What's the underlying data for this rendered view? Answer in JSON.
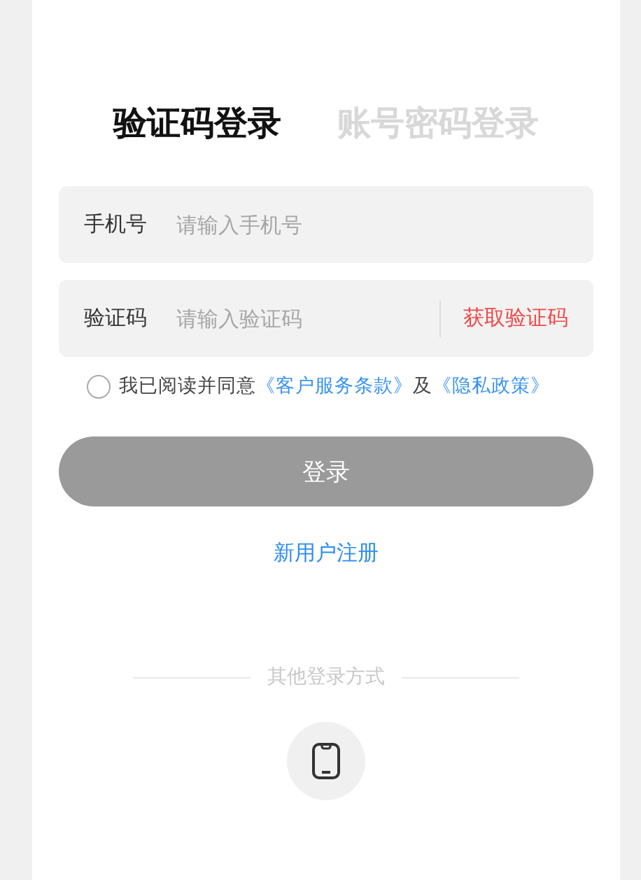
{
  "tabs": [
    {
      "label": "验证码登录",
      "selected": true
    },
    {
      "label": "账号密码登录",
      "selected": false
    }
  ],
  "fields": [
    {
      "label": "手机号",
      "placeholder": "请输入手机号"
    },
    {
      "label": "验证码",
      "placeholder": "请输入验证码",
      "action": "获取验证码"
    }
  ],
  "agreement": {
    "checked": false,
    "text": "我已阅读并同意",
    "link_1": "《客户服务条款》",
    "joiner": "及",
    "link_2": "《隐私政策》"
  },
  "login_button": {
    "label": "登录",
    "disabled": true
  },
  "register_link": "新用户注册",
  "other_methods": {
    "title": "其他登录方式"
  }
}
